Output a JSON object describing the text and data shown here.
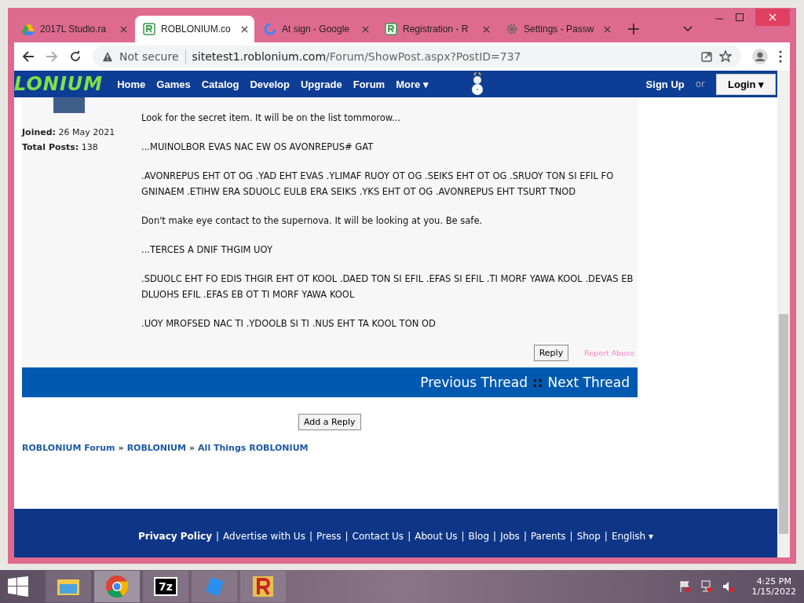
{
  "tabs": [
    {
      "title": "2017L Studio.ra",
      "selected": false
    },
    {
      "title": "ROBLONIUM.co",
      "selected": true
    },
    {
      "title": "At sign - Google",
      "selected": false
    },
    {
      "title": "Registration - R",
      "selected": false
    },
    {
      "title": "Settings - Passw",
      "selected": false
    }
  ],
  "address": {
    "security": "Not secure",
    "host": "sitetest1.roblonium.com",
    "path": "/Forum/ShowPost.aspx?PostID=737"
  },
  "site": {
    "logo": "LONIUM",
    "nav": [
      "Home",
      "Games",
      "Catalog",
      "Develop",
      "Upgrade",
      "Forum",
      "More ▾"
    ],
    "sign_up": "Sign Up",
    "or": "or",
    "login": "Login ▾"
  },
  "user": {
    "joined_label": "Joined:",
    "joined": "26 May 2021",
    "posts_label": "Total Posts:",
    "posts": "138"
  },
  "post": {
    "paragraphs": [
      "Look for the secret item. It will be on the list tommorow...",
      "...MUINOLBOR EVAS NAC EW OS AVONREPUS# GAT",
      ".AVONREPUS EHT OT OG .YAD EHT EVAS .YLIMAF RUOY OT OG .SEIKS EHT OT OG .SRUOY TON SI EFIL FO GNINAEM .ETIHW ERA SDUOLC EULB ERA SEIKS .YKS EHT OT OG .AVONREPUS EHT TSURT TNOD",
      "Don't make eye contact to the supernova. It will be looking at you. Be safe.",
      "...TERCES A DNIF THGIM UOY",
      ".SDUOLC EHT FO EDIS THGIR EHT OT KOOL .DAED TON SI EFIL .EFAS SI EFIL .TI MORF YAWA KOOL .DEVAS EB DLUOHS EFIL .EFAS EB OT TI MORF YAWA KOOL",
      ".UOY MROFSED NAC TI .YDOOLB SI TI .NUS EHT TA KOOL TON OD"
    ],
    "reply": "Reply",
    "report": "Report Abuse"
  },
  "thread_nav": {
    "previous": "Previous Thread",
    "separator": "::",
    "next": "Next Thread"
  },
  "add_reply": "Add a Reply",
  "breadcrumb": [
    {
      "label": "ROBLONIUM Forum"
    },
    {
      "separator": "»",
      "label": "ROBLONIUM"
    },
    {
      "separator": "»",
      "label": "All Things ROBLONIUM"
    }
  ],
  "footer": {
    "links": [
      {
        "label": "Privacy Policy",
        "bold": true
      },
      {
        "separator": "|",
        "label": "Advertise with Us",
        "bold": false
      },
      {
        "separator": "|",
        "label": "Press",
        "bold": false
      },
      {
        "separator": "|",
        "label": "Contact Us",
        "bold": false
      },
      {
        "separator": "|",
        "label": "About Us",
        "bold": false
      },
      {
        "separator": "|",
        "label": "Blog",
        "bold": false
      },
      {
        "separator": "|",
        "label": "Jobs",
        "bold": false
      },
      {
        "separator": "|",
        "label": "Parents",
        "bold": false
      },
      {
        "separator": "|",
        "label": "Shop",
        "bold": false
      },
      {
        "separator": "|",
        "label": "English ▾",
        "bold": false
      }
    ]
  },
  "taskbar": {
    "apps": [
      {
        "kind": "files",
        "selected": false
      },
      {
        "kind": "chrome",
        "selected": true
      },
      {
        "kind": "archiver",
        "label": "7z",
        "selected": false
      },
      {
        "kind": "blue",
        "selected": false
      },
      {
        "kind": "r",
        "selected": false
      }
    ],
    "time": "4:25 PM",
    "date": "1/15/2022"
  }
}
